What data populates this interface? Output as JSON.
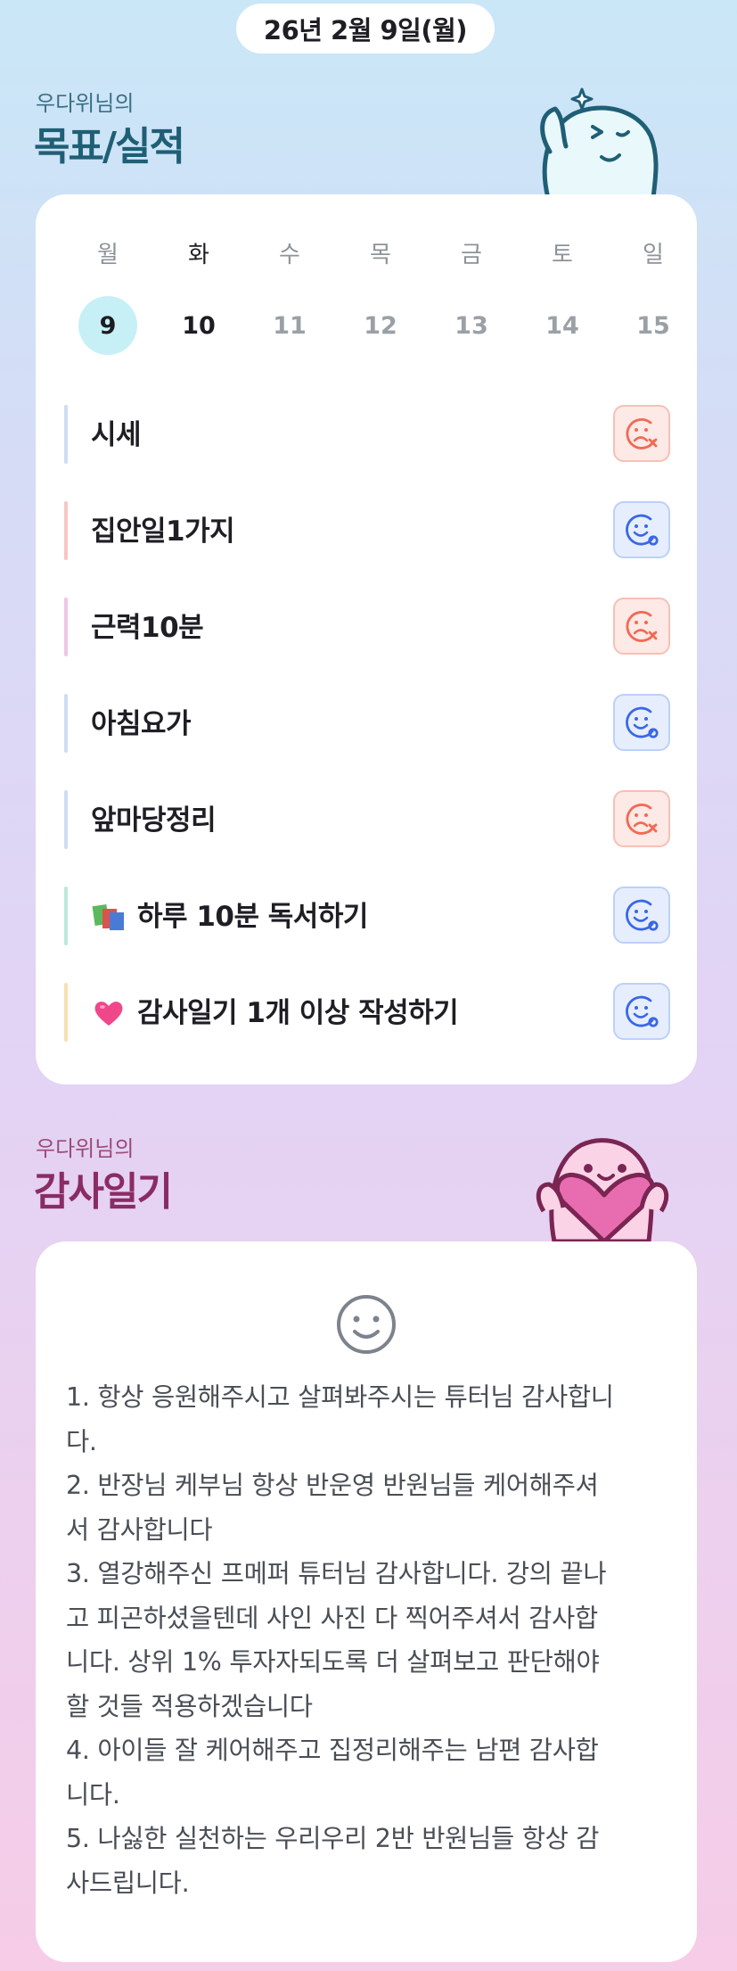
{
  "header": {
    "date": "26년 2월 9일(월)"
  },
  "goal_section": {
    "subtitle": "우다위님의",
    "title": "목표/실적",
    "title_color": "#1f5f75",
    "subtitle_color": "#3d6f86"
  },
  "calendar": {
    "days": [
      {
        "label": "월",
        "number": "9",
        "state": "today"
      },
      {
        "label": "화",
        "number": "10",
        "state": "active"
      },
      {
        "label": "수",
        "number": "11",
        "state": "normal"
      },
      {
        "label": "목",
        "number": "12",
        "state": "normal"
      },
      {
        "label": "금",
        "number": "13",
        "state": "normal"
      },
      {
        "label": "토",
        "number": "14",
        "state": "normal"
      },
      {
        "label": "일",
        "number": "15",
        "state": "normal"
      }
    ],
    "today_highlight_color": "#c6f0f6"
  },
  "goals": [
    {
      "text": "시세",
      "bar_color": "#cfdcf4",
      "status": "fail",
      "icon": "sad-face-x-icon"
    },
    {
      "text": "집안일1가지",
      "bar_color": "#f6c6c4",
      "status": "success",
      "icon": "smile-face-o-icon"
    },
    {
      "text": "근력10분",
      "bar_color": "#efc6e6",
      "status": "fail",
      "icon": "sad-face-x-icon"
    },
    {
      "text": "아침요가",
      "bar_color": "#cfdcf4",
      "status": "success",
      "icon": "smile-face-o-icon"
    },
    {
      "text": "앞마당정리",
      "bar_color": "#cfdcf4",
      "status": "fail",
      "icon": "sad-face-x-icon"
    },
    {
      "text": "하루 10분 독서하기",
      "bar_color": "#bde8dc",
      "status": "success",
      "icon": "smile-face-o-icon",
      "emoji": "books-icon"
    },
    {
      "text": "감사일기 1개 이상 작성하기",
      "bar_color": "#f7e1b0",
      "status": "success",
      "icon": "smile-face-o-icon",
      "emoji": "heart-icon"
    }
  ],
  "status_colors": {
    "fail": "#f06a55",
    "success": "#3a67e6"
  },
  "gratitude_section": {
    "subtitle": "우다위님의",
    "title": "감사일기",
    "title_color": "#8a2c63",
    "subtitle_color": "#9b4a78"
  },
  "gratitude": {
    "mood_icon": "smile-face-icon",
    "lines": [
      "1. 항상 응원해주시고 살펴봐주시는 튜터님 감사합니",
      "다.",
      "2. 반장님 케부님 항상 반운영 반원님들 케어해주셔",
      "서 감사합니다",
      "3. 열강해주신 프메퍼 튜터님 감사합니다. 강의 끝나",
      "고 피곤하셨을텐데 사인 사진 다 찍어주셔서 감사합",
      "니다. 상위 1% 투자자되도록 더 살펴보고 판단해야",
      "할 것들 적용하겠습니다",
      "4. 아이들 잘 케어해주고 집정리해주는 남편 감사합",
      "니다.",
      "5. 나싫한 실천하는 우리우리 2반 반원님들 항상 감",
      "사드립니다."
    ]
  }
}
